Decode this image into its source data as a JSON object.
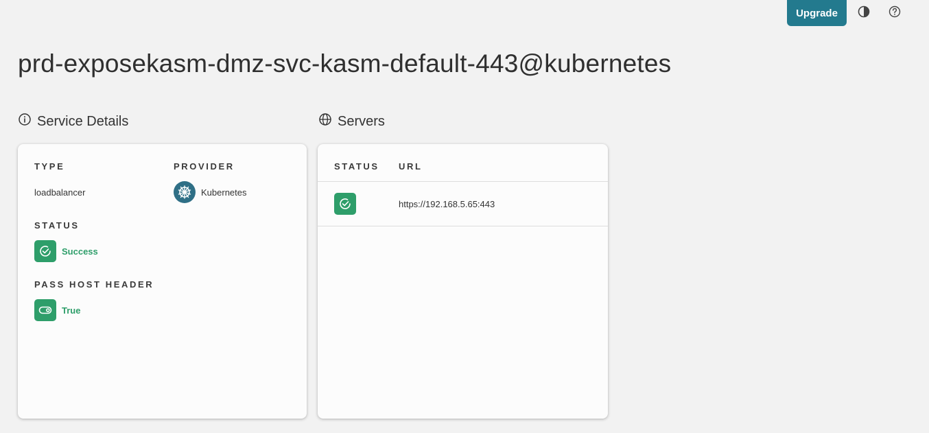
{
  "header": {
    "upgrade_label": "Upgrade",
    "theme_icon": "contrast-icon",
    "help_icon": "help-circle-icon"
  },
  "page": {
    "title": "prd-exposekasm-dmz-svc-kasm-default-443@kubernetes"
  },
  "service_details": {
    "heading": "Service Details",
    "heading_icon": "info-circle-icon",
    "type_label": "TYPE",
    "type_value": "loadbalancer",
    "provider_label": "PROVIDER",
    "provider_value": "Kubernetes",
    "provider_icon": "kubernetes-icon",
    "status_label": "STATUS",
    "status_value": "Success",
    "pass_host_header_label": "PASS HOST HEADER",
    "pass_host_header_value": "True"
  },
  "servers": {
    "heading": "Servers",
    "heading_icon": "globe-icon",
    "columns": [
      "STATUS",
      "URL"
    ],
    "rows": [
      {
        "status": "success",
        "url": "https://192.168.5.65:443"
      }
    ]
  },
  "colors": {
    "accent": "#237a8e",
    "success": "#2e9e6a",
    "background": "#f2f2f2",
    "card": "#fcfcfc"
  }
}
